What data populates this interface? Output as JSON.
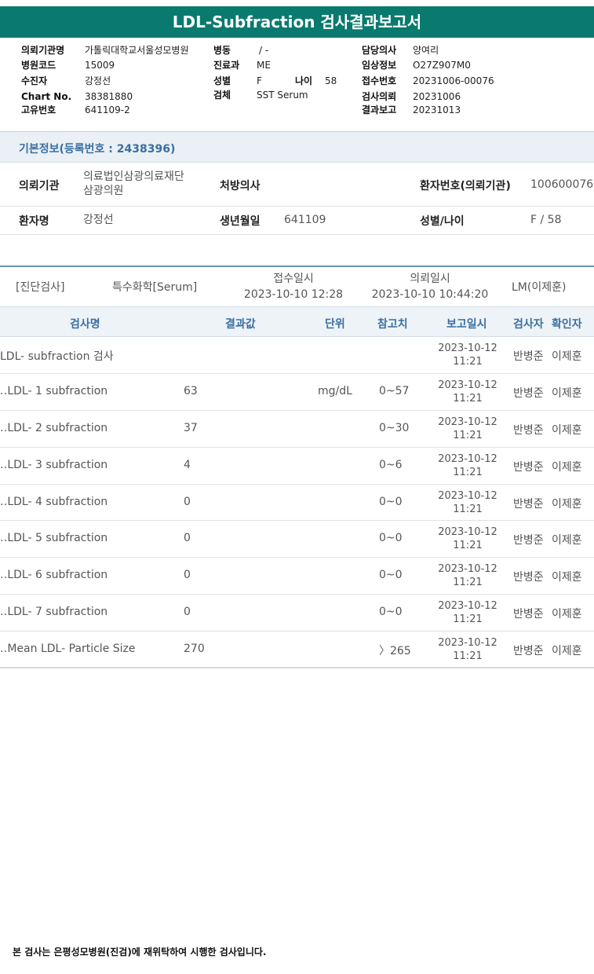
{
  "title": "LDL-Subfraction 검사결과보고서",
  "header": {
    "col1": [
      {
        "label": "의뢰기관명",
        "value": "가톨릭대학교서울성모병원"
      },
      {
        "label": "병원코드",
        "value": "15009"
      },
      {
        "label": "수진자",
        "value": "강정선"
      },
      {
        "label": "Chart No.",
        "value": "38381880"
      },
      {
        "label": "고유번호",
        "value": "641109-2"
      }
    ],
    "col2": [
      {
        "label": "병동",
        "value": "/ -"
      },
      {
        "label": "진료과",
        "value": "ME"
      },
      {
        "label": "성별",
        "value": "F"
      },
      {
        "label": "검체",
        "value": "SST Serum"
      }
    ],
    "age_label": "나이",
    "age_value": "58",
    "col3": [
      {
        "label": "담당의사",
        "value": "양여리"
      },
      {
        "label": "임상정보",
        "value": "O27Z907M0"
      },
      {
        "label": "접수번호",
        "value": "20231006-00076"
      },
      {
        "label": "검사의뢰",
        "value": "20231006"
      },
      {
        "label": "결과보고",
        "value": "20231013"
      }
    ]
  },
  "basic_info": {
    "section_title": "기본정보(등록번호 : 2438396)",
    "institution_label": "의뢰기관",
    "institution_line1": "의료법인삼광의료재단",
    "institution_line2": "삼광의원",
    "doctor_label": "처방의사",
    "doctor_value": "",
    "patient_no_label": "환자번호(의뢰기관)",
    "patient_no_value": "100600076",
    "patient_name_label": "환자명",
    "patient_name_value": "강정선",
    "birth_label": "생년월일",
    "birth_value": "641109",
    "sex_age_label": "성별/나이",
    "sex_age_value": "F / 58"
  },
  "order": {
    "category": "[진단검사]",
    "specimen": "특수화학[Serum]",
    "received_label": "접수일시",
    "received_value": "2023-10-10 12:28",
    "requested_label": "의뢰일시",
    "requested_value": "2023-10-10 10:44:20",
    "lm": "LM(이제훈)"
  },
  "table": {
    "headers": {
      "name": "검사명",
      "result": "결과값",
      "unit": "단위",
      "reference": "참고치",
      "report_date": "보고일시",
      "tester": "검사자",
      "checker": "확인자"
    },
    "rows": [
      {
        "name": "LDL- subfraction 검사",
        "result": "",
        "unit": "",
        "reference": "",
        "date": "2023-10-12",
        "time": "11:21",
        "tester": "반병준",
        "checker": "이제훈"
      },
      {
        "name": "‥LDL- 1 subfraction",
        "result": "63",
        "unit": "mg/dL",
        "reference": "0~57",
        "date": "2023-10-12",
        "time": "11:21",
        "tester": "반병준",
        "checker": "이제훈"
      },
      {
        "name": "‥LDL- 2 subfraction",
        "result": "37",
        "unit": "",
        "reference": "0~30",
        "date": "2023-10-12",
        "time": "11:21",
        "tester": "반병준",
        "checker": "이제훈"
      },
      {
        "name": "‥LDL- 3 subfraction",
        "result": "4",
        "unit": "",
        "reference": "0~6",
        "date": "2023-10-12",
        "time": "11:21",
        "tester": "반병준",
        "checker": "이제훈"
      },
      {
        "name": "‥LDL- 4 subfraction",
        "result": "0",
        "unit": "",
        "reference": "0~0",
        "date": "2023-10-12",
        "time": "11:21",
        "tester": "반병준",
        "checker": "이제훈"
      },
      {
        "name": "‥LDL- 5 subfraction",
        "result": "0",
        "unit": "",
        "reference": "0~0",
        "date": "2023-10-12",
        "time": "11:21",
        "tester": "반병준",
        "checker": "이제훈"
      },
      {
        "name": "‥LDL- 6 subfraction",
        "result": "0",
        "unit": "",
        "reference": "0~0",
        "date": "2023-10-12",
        "time": "11:21",
        "tester": "반병준",
        "checker": "이제훈"
      },
      {
        "name": "‥LDL- 7 subfraction",
        "result": "0",
        "unit": "",
        "reference": "0~0",
        "date": "2023-10-12",
        "time": "11:21",
        "tester": "반병준",
        "checker": "이제훈"
      },
      {
        "name": "‥Mean LDL- Particle Size",
        "result": "270",
        "unit": "",
        "reference": "〉265",
        "date": "2023-10-12",
        "time": "11:21",
        "tester": "반병준",
        "checker": "이제훈"
      }
    ]
  },
  "footer": "본 검사는 은평성모병원(진검)에 재위탁하여 시행한 검사입니다.",
  "colors": {
    "banner": "#0a7a6f",
    "section_text": "#3a6fa0",
    "section_bg": "#eaf0f5"
  }
}
